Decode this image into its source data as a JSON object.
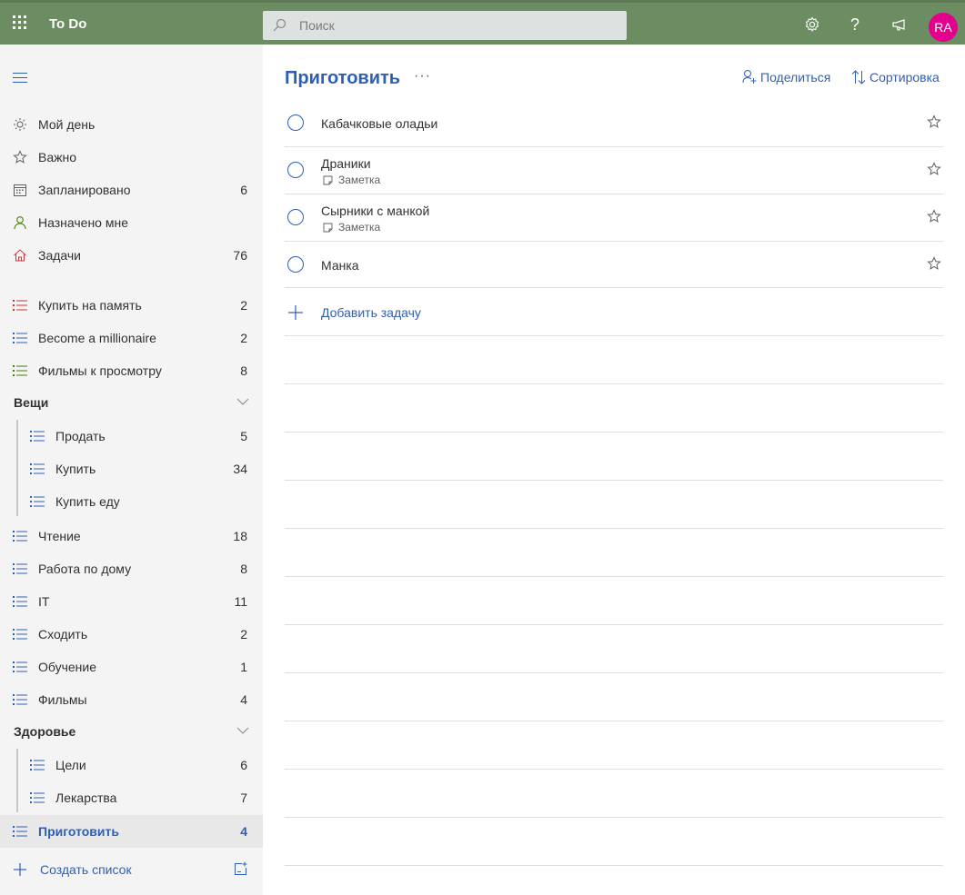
{
  "header": {
    "app_title": "To Do",
    "search_placeholder": "Поиск",
    "avatar_initials": "RA",
    "avatar_color": "#e3008c",
    "bar_color": "#6c8c62"
  },
  "sidebar": {
    "smart_lists": [
      {
        "label": "Мой день",
        "count": "",
        "icon": "sun-icon"
      },
      {
        "label": "Важно",
        "count": "",
        "icon": "star-icon"
      },
      {
        "label": "Запланировано",
        "count": "6",
        "icon": "calendar-icon"
      },
      {
        "label": "Назначено мне",
        "count": "",
        "icon": "person-icon"
      },
      {
        "label": "Задачи",
        "count": "76",
        "icon": "home-icon"
      }
    ],
    "lists": [
      {
        "label": "Купить на память",
        "count": "2",
        "icon_color": "#d13438"
      },
      {
        "label": "Become a millionaire",
        "count": "2",
        "icon_color": "#2e5fb7"
      },
      {
        "label": "Фильмы к просмотру",
        "count": "8",
        "icon_color": "#498205"
      }
    ],
    "group1": {
      "label": "Вещи",
      "items": [
        {
          "label": "Продать",
          "count": "5"
        },
        {
          "label": "Купить",
          "count": "34"
        },
        {
          "label": "Купить еду",
          "count": ""
        }
      ]
    },
    "lists2": [
      {
        "label": "Чтение",
        "count": "18"
      },
      {
        "label": "Работа по дому",
        "count": "8"
      },
      {
        "label": "IT",
        "count": "11"
      },
      {
        "label": "Сходить",
        "count": "2"
      },
      {
        "label": "Обучение",
        "count": "1"
      },
      {
        "label": "Фильмы",
        "count": "4"
      }
    ],
    "group2": {
      "label": "Здоровье",
      "items": [
        {
          "label": "Цели",
          "count": "6"
        },
        {
          "label": "Лекарства",
          "count": "7"
        }
      ]
    },
    "active_list": {
      "label": "Приготовить",
      "count": "4"
    },
    "create_list_label": "Создать список"
  },
  "main": {
    "title": "Приготовить",
    "more_label": "···",
    "share_label": "Поделиться",
    "sort_label": "Сортировка",
    "tasks": [
      {
        "name": "Кабачковые оладьи",
        "note": ""
      },
      {
        "name": "Драники",
        "note": "Заметка"
      },
      {
        "name": "Сырники с манкой",
        "note": "Заметка"
      },
      {
        "name": "Манка",
        "note": ""
      }
    ],
    "add_task_label": "Добавить задачу",
    "accent_color": "#2e5fb7"
  }
}
